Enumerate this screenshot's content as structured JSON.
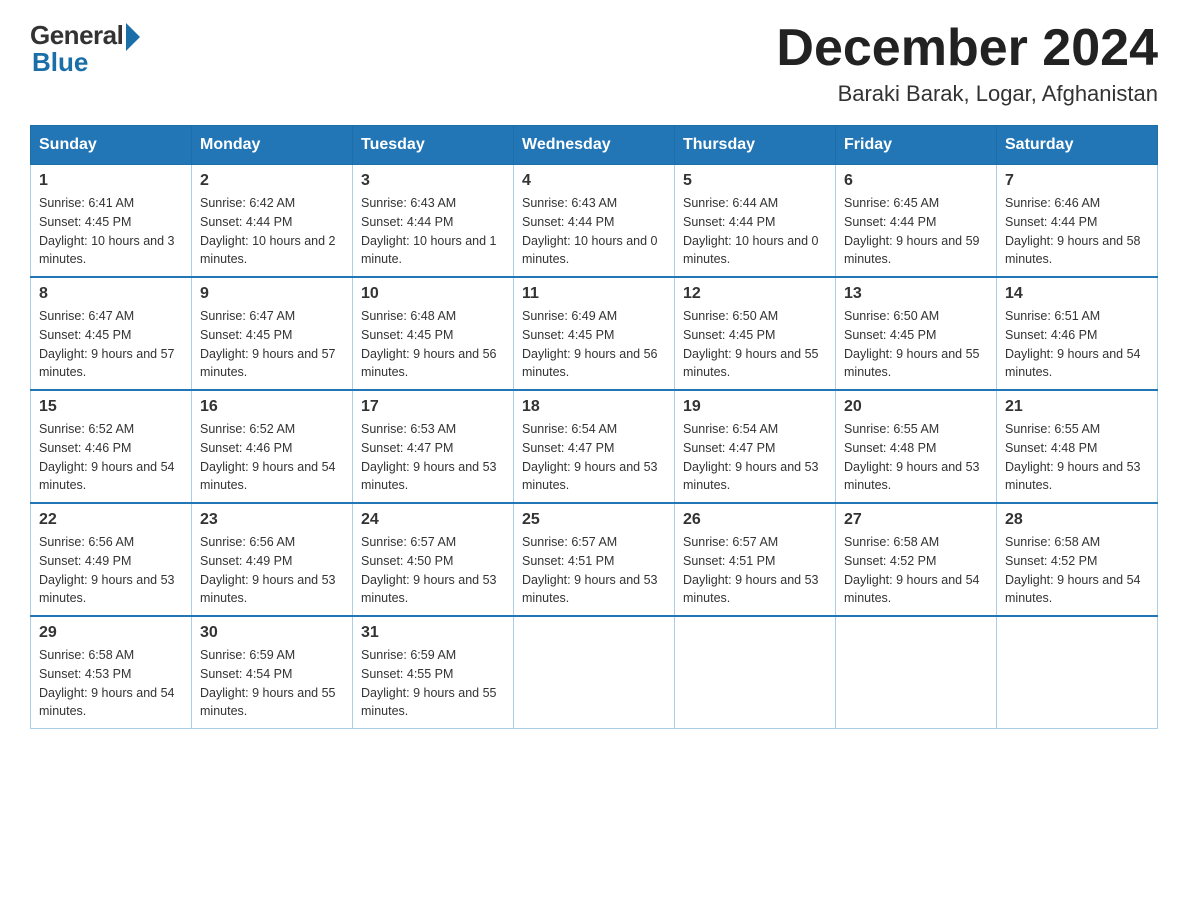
{
  "header": {
    "logo_general": "General",
    "logo_blue": "Blue",
    "month_title": "December 2024",
    "location": "Baraki Barak, Logar, Afghanistan"
  },
  "weekdays": [
    "Sunday",
    "Monday",
    "Tuesday",
    "Wednesday",
    "Thursday",
    "Friday",
    "Saturday"
  ],
  "weeks": [
    [
      {
        "day": "1",
        "sunrise": "6:41 AM",
        "sunset": "4:45 PM",
        "daylight": "10 hours and 3 minutes."
      },
      {
        "day": "2",
        "sunrise": "6:42 AM",
        "sunset": "4:44 PM",
        "daylight": "10 hours and 2 minutes."
      },
      {
        "day": "3",
        "sunrise": "6:43 AM",
        "sunset": "4:44 PM",
        "daylight": "10 hours and 1 minute."
      },
      {
        "day": "4",
        "sunrise": "6:43 AM",
        "sunset": "4:44 PM",
        "daylight": "10 hours and 0 minutes."
      },
      {
        "day": "5",
        "sunrise": "6:44 AM",
        "sunset": "4:44 PM",
        "daylight": "10 hours and 0 minutes."
      },
      {
        "day": "6",
        "sunrise": "6:45 AM",
        "sunset": "4:44 PM",
        "daylight": "9 hours and 59 minutes."
      },
      {
        "day": "7",
        "sunrise": "6:46 AM",
        "sunset": "4:44 PM",
        "daylight": "9 hours and 58 minutes."
      }
    ],
    [
      {
        "day": "8",
        "sunrise": "6:47 AM",
        "sunset": "4:45 PM",
        "daylight": "9 hours and 57 minutes."
      },
      {
        "day": "9",
        "sunrise": "6:47 AM",
        "sunset": "4:45 PM",
        "daylight": "9 hours and 57 minutes."
      },
      {
        "day": "10",
        "sunrise": "6:48 AM",
        "sunset": "4:45 PM",
        "daylight": "9 hours and 56 minutes."
      },
      {
        "day": "11",
        "sunrise": "6:49 AM",
        "sunset": "4:45 PM",
        "daylight": "9 hours and 56 minutes."
      },
      {
        "day": "12",
        "sunrise": "6:50 AM",
        "sunset": "4:45 PM",
        "daylight": "9 hours and 55 minutes."
      },
      {
        "day": "13",
        "sunrise": "6:50 AM",
        "sunset": "4:45 PM",
        "daylight": "9 hours and 55 minutes."
      },
      {
        "day": "14",
        "sunrise": "6:51 AM",
        "sunset": "4:46 PM",
        "daylight": "9 hours and 54 minutes."
      }
    ],
    [
      {
        "day": "15",
        "sunrise": "6:52 AM",
        "sunset": "4:46 PM",
        "daylight": "9 hours and 54 minutes."
      },
      {
        "day": "16",
        "sunrise": "6:52 AM",
        "sunset": "4:46 PM",
        "daylight": "9 hours and 54 minutes."
      },
      {
        "day": "17",
        "sunrise": "6:53 AM",
        "sunset": "4:47 PM",
        "daylight": "9 hours and 53 minutes."
      },
      {
        "day": "18",
        "sunrise": "6:54 AM",
        "sunset": "4:47 PM",
        "daylight": "9 hours and 53 minutes."
      },
      {
        "day": "19",
        "sunrise": "6:54 AM",
        "sunset": "4:47 PM",
        "daylight": "9 hours and 53 minutes."
      },
      {
        "day": "20",
        "sunrise": "6:55 AM",
        "sunset": "4:48 PM",
        "daylight": "9 hours and 53 minutes."
      },
      {
        "day": "21",
        "sunrise": "6:55 AM",
        "sunset": "4:48 PM",
        "daylight": "9 hours and 53 minutes."
      }
    ],
    [
      {
        "day": "22",
        "sunrise": "6:56 AM",
        "sunset": "4:49 PM",
        "daylight": "9 hours and 53 minutes."
      },
      {
        "day": "23",
        "sunrise": "6:56 AM",
        "sunset": "4:49 PM",
        "daylight": "9 hours and 53 minutes."
      },
      {
        "day": "24",
        "sunrise": "6:57 AM",
        "sunset": "4:50 PM",
        "daylight": "9 hours and 53 minutes."
      },
      {
        "day": "25",
        "sunrise": "6:57 AM",
        "sunset": "4:51 PM",
        "daylight": "9 hours and 53 minutes."
      },
      {
        "day": "26",
        "sunrise": "6:57 AM",
        "sunset": "4:51 PM",
        "daylight": "9 hours and 53 minutes."
      },
      {
        "day": "27",
        "sunrise": "6:58 AM",
        "sunset": "4:52 PM",
        "daylight": "9 hours and 54 minutes."
      },
      {
        "day": "28",
        "sunrise": "6:58 AM",
        "sunset": "4:52 PM",
        "daylight": "9 hours and 54 minutes."
      }
    ],
    [
      {
        "day": "29",
        "sunrise": "6:58 AM",
        "sunset": "4:53 PM",
        "daylight": "9 hours and 54 minutes."
      },
      {
        "day": "30",
        "sunrise": "6:59 AM",
        "sunset": "4:54 PM",
        "daylight": "9 hours and 55 minutes."
      },
      {
        "day": "31",
        "sunrise": "6:59 AM",
        "sunset": "4:55 PM",
        "daylight": "9 hours and 55 minutes."
      },
      null,
      null,
      null,
      null
    ]
  ]
}
